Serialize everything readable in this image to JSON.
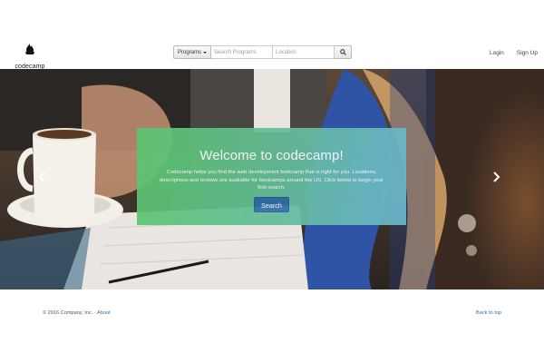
{
  "navbar": {
    "brand": "codecamp",
    "programs_label": "Programs",
    "search_placeholder": "Search Programs",
    "location_placeholder": "Location",
    "login": "Login",
    "signup": "Sign Up"
  },
  "hero": {
    "title": "Welcome to codecamp!",
    "description": "Codecamp helps you find the web development bootcamp that is right for you. Locations, descriptions and reviews are available for bootcamps around the US. Click below to begin your first search.",
    "button": "Search"
  },
  "footer": {
    "copyright": "© 2016 Company, Inc. ·",
    "about": "About",
    "back_to_top": "Back to top"
  },
  "colors": {
    "accent": "#2f6ea8",
    "welcome_gradient_start": "#5cc56c",
    "welcome_gradient_end": "#6cb6cf"
  },
  "icons": [
    "flame-logo-icon",
    "caret-down-icon",
    "search-icon",
    "chevron-left-icon",
    "chevron-right-icon"
  ]
}
